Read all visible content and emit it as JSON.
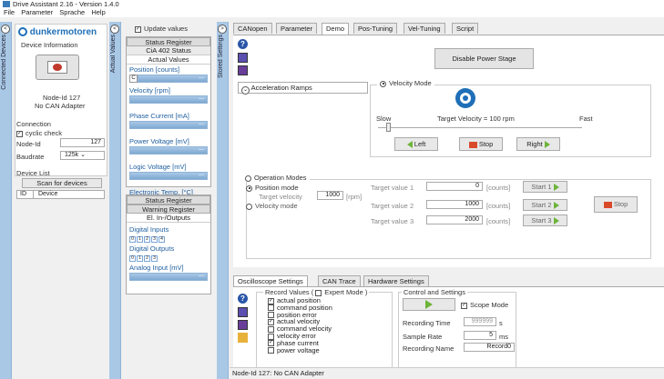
{
  "app": {
    "title": "Drive Assistant 2.16 - Version 1.4.0"
  },
  "menu": [
    "File",
    "Parameter",
    "Sprache",
    "Help"
  ],
  "rails": {
    "connected_devices": "Connected Devices",
    "actual_values": "Actual Values",
    "stored_settings": "Stored Settings"
  },
  "device": {
    "logo": "dunkermotoren",
    "info_title": "Device Information",
    "node_label": "Node-Id 127",
    "adapter_label": "No CAN Adapter",
    "connection_title": "Connection",
    "cyclic_check": "cyclic check",
    "node_id_label": "Node-Id",
    "node_id_value": "127",
    "baudrate_label": "Baudrate",
    "baudrate_value": "125k",
    "device_list_title": "Device List",
    "scan_button": "Scan for devices",
    "list_cols": [
      "ID",
      "Device"
    ]
  },
  "status": {
    "update_values": "Update values",
    "header": "Status Register",
    "sub": "CiA 402 Status",
    "actual_values_title": "Actual Values",
    "position_label": "Position [counts]",
    "position_c": "C",
    "values": [
      {
        "label": "Velocity [rpm]",
        "value": "---"
      },
      {
        "label": "Phase Current [mA]",
        "value": "---"
      },
      {
        "label": "Power Voltage [mV]",
        "value": "---"
      },
      {
        "label": "Logic Voltage [mV]",
        "value": "---"
      },
      {
        "label": "Electronic Temp. [°C]",
        "value": "---"
      }
    ],
    "position_value": "---",
    "status_register_2": "Status Register",
    "warning_register": "Warning Register",
    "el_io": "El. In-/Outputs",
    "digital_inputs": "Digital Inputs",
    "di": [
      "0",
      "1",
      "2",
      "3",
      "4"
    ],
    "digital_outputs": "Digital Outputs",
    "do": [
      "0",
      "1",
      "2",
      "3"
    ],
    "analog_input": "Analog Input [mV]",
    "analog_value": "---"
  },
  "tabs": [
    "CANopen",
    "Parameter",
    "Demo",
    "Pos-Tuning",
    "Vel-Tuning",
    "Script"
  ],
  "active_tab": "Demo",
  "demo": {
    "disable_power": "Disable Power Stage",
    "accel_ramps": "Acceleration Ramps",
    "velocity_mode": "Velocity Mode",
    "slow": "Slow",
    "target_velocity": "Target Velocity = 100 rpm",
    "fast": "Fast",
    "left": "Left",
    "stop": "Stop",
    "right": "Right",
    "operation_modes": "Operation Modes",
    "position_mode": "Position mode",
    "target_velocity_label": "Target velocity",
    "target_velocity_value": "1000",
    "target_velocity_unit": "[rpm]",
    "velocity_mode_radio": "Velocity mode",
    "targets": [
      {
        "label": "Target value 1",
        "value": "0",
        "unit": "[counts]",
        "button": "Start 1"
      },
      {
        "label": "Target value 2",
        "value": "1000",
        "unit": "[counts]",
        "button": "Start 2"
      },
      {
        "label": "Target value 3",
        "value": "2000",
        "unit": "[counts]",
        "button": "Start 3"
      }
    ],
    "stop_big": "Stop"
  },
  "scope": {
    "tabs": [
      "Oscilloscope Settings",
      "CAN Trace",
      "Hardware Settings"
    ],
    "record_values": "Record Values (",
    "expert_mode": "Expert Mode )",
    "signals": [
      {
        "label": "actual position",
        "checked": true
      },
      {
        "label": "command position",
        "checked": false
      },
      {
        "label": "position error",
        "checked": false
      },
      {
        "label": "actual velocity",
        "checked": true
      },
      {
        "label": "command velocity",
        "checked": false
      },
      {
        "label": "velocity error",
        "checked": false
      },
      {
        "label": "phase current",
        "checked": true
      },
      {
        "label": "power voltage",
        "checked": false
      }
    ],
    "control_title": "Control and Settings",
    "scope_mode": "Scope Mode",
    "recording_time_label": "Recording Time",
    "recording_time_value": "999999",
    "recording_time_unit": "s",
    "sample_rate_label": "Sample Rate",
    "sample_rate_value": "5",
    "sample_rate_unit": "ms",
    "recording_name_label": "Recording Name",
    "recording_name_value": "Record0"
  },
  "statusbar": "Node-Id 127: No CAN Adapter",
  "colors": {
    "accent": "#a9c8e6",
    "green": "#6db43a",
    "red": "#d94a2a",
    "brand_blue": "#1f6fb8"
  }
}
